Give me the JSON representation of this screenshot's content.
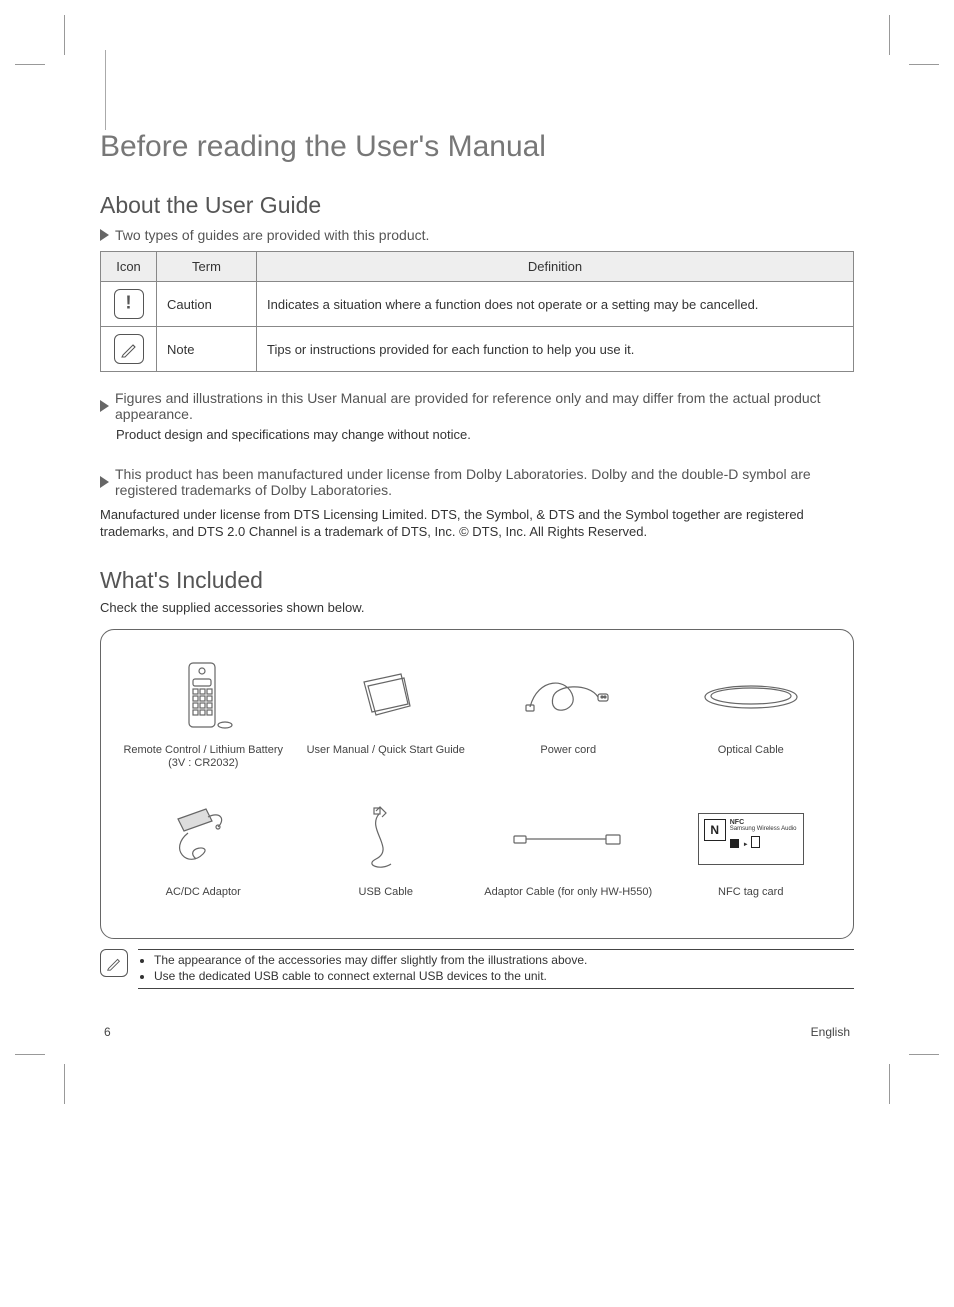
{
  "page": {
    "number": "6",
    "language": "English"
  },
  "title": "Before reading the User's Manual",
  "section1": {
    "heading": "About the User Guide",
    "sub1": "Two types of guides are provided with this product.",
    "table": {
      "headers": {
        "icon": "Icon",
        "term": "Term",
        "definition": "Definition"
      },
      "rows": [
        {
          "term": "Caution",
          "definition": "Indicates a situation where a function does not operate or a setting may be cancelled."
        },
        {
          "term": "Note",
          "definition": "Tips or instructions provided for each function to help you use it."
        }
      ]
    },
    "sub2": "Figures and illustrations in this User Manual are provided for reference only and may differ from the actual product appearance.",
    "para2": "Product design and specifications may change without notice.",
    "sub3": "This product has been manufactured under license from Dolby Laboratories. Dolby and the double-D symbol are registered trademarks of Dolby Laboratories.",
    "para3": "Manufactured under license from DTS Licensing Limited. DTS, the Symbol, & DTS and the Symbol together are registered trademarks, and DTS 2.0 Channel is a trademark of DTS, Inc. © DTS, Inc. All Rights Reserved."
  },
  "section2": {
    "heading": "What's Included",
    "intro": "Check the supplied accessories shown below.",
    "items": [
      {
        "name": "remote-control-item",
        "label": "Remote Control / Lithium Battery\n(3V : CR2032)"
      },
      {
        "name": "user-manual-item",
        "label": "User Manual /\nQuick Start Guide"
      },
      {
        "name": "power-cord-item",
        "label": "Power cord"
      },
      {
        "name": "optical-cable-item",
        "label": "Optical Cable"
      },
      {
        "name": "ac-dc-adapter-item",
        "label": "AC/DC Adaptor"
      },
      {
        "name": "usb-cable-item",
        "label": "USB Cable"
      },
      {
        "name": "adapter-cable-item",
        "label": "Adaptor Cable\n(for only HW-H550)"
      },
      {
        "name": "nfc-tag-item",
        "label": "NFC tag card"
      }
    ],
    "notes": [
      "The appearance of the accessories may differ slightly from the illustrations above.",
      "Use the dedicated USB cable to connect external USB devices to the unit."
    ]
  }
}
